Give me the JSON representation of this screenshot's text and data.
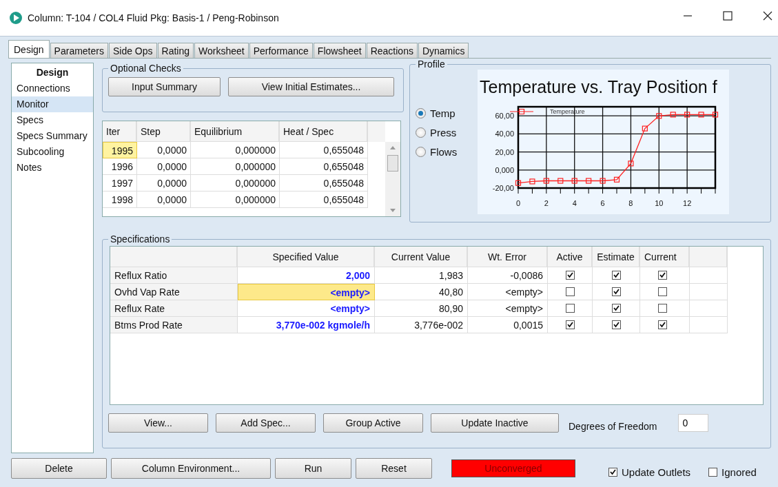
{
  "window": {
    "title": "Column: T-104 / COL4  Fluid Pkg: Basis-1 / Peng-Robinson"
  },
  "tabs": [
    {
      "label": "Design",
      "selected": true
    },
    {
      "label": "Parameters",
      "selected": false
    },
    {
      "label": "Side Ops",
      "selected": false
    },
    {
      "label": "Rating",
      "selected": false
    },
    {
      "label": "Worksheet",
      "selected": false
    },
    {
      "label": "Performance",
      "selected": false
    },
    {
      "label": "Flowsheet",
      "selected": false
    },
    {
      "label": "Reactions",
      "selected": false
    },
    {
      "label": "Dynamics",
      "selected": false
    }
  ],
  "sidebar": {
    "heading": "Design",
    "items": [
      {
        "label": "Connections",
        "selected": false
      },
      {
        "label": "Monitor",
        "selected": true
      },
      {
        "label": "Specs",
        "selected": false
      },
      {
        "label": "Specs Summary",
        "selected": false
      },
      {
        "label": "Subcooling",
        "selected": false
      },
      {
        "label": "Notes",
        "selected": false
      }
    ]
  },
  "optional_checks": {
    "title": "Optional Checks",
    "buttons": [
      "Input Summary",
      "View Initial Estimates..."
    ]
  },
  "iterations": {
    "columns": [
      "Iter",
      "Step",
      "Equilibrium",
      "Heat / Spec"
    ],
    "rows": [
      {
        "cells": [
          "1995",
          "0,0000",
          "0,000000",
          "0,655048"
        ],
        "selected": true
      },
      {
        "cells": [
          "1996",
          "0,0000",
          "0,000000",
          "0,655048"
        ],
        "selected": false
      },
      {
        "cells": [
          "1997",
          "0,0000",
          "0,000000",
          "0,655048"
        ],
        "selected": false
      },
      {
        "cells": [
          "1998",
          "0,0000",
          "0,000000",
          "0,655048"
        ],
        "selected": false
      }
    ]
  },
  "profile": {
    "title": "Profile",
    "options": [
      {
        "label": "Temp",
        "selected": true
      },
      {
        "label": "Press",
        "selected": false
      },
      {
        "label": "Flows",
        "selected": false
      }
    ],
    "chart_data": {
      "type": "line",
      "title": "Temperature vs. Tray Position f",
      "x": [
        0,
        1,
        2,
        3,
        4,
        5,
        6,
        7,
        8,
        9,
        10,
        11,
        12,
        13,
        14
      ],
      "grid": true,
      "series": [
        {
          "name": "Temperature",
          "color": "#ff2020",
          "marker": "square",
          "values": [
            -14.4,
            -12.7,
            -12,
            -12,
            -12,
            -12,
            -12,
            -10.7,
            7.2,
            45.9,
            59.8,
            61.3,
            61.3,
            61.3,
            61.3
          ]
        }
      ],
      "xlim": [
        0,
        14
      ],
      "ylim": [
        -20,
        70
      ],
      "xticks": [
        0,
        2,
        4,
        6,
        8,
        10,
        12
      ],
      "yticks": [
        {
          "value": -20,
          "label": "-20,00"
        },
        {
          "value": 0,
          "label": "0,000"
        },
        {
          "value": 20,
          "label": "20,00"
        },
        {
          "value": 40,
          "label": "40,00"
        },
        {
          "value": 60,
          "label": "60,00"
        }
      ]
    }
  },
  "specifications": {
    "title": "Specifications",
    "columns": [
      "Specified Value",
      "Current Value",
      "Wt. Error",
      "Active",
      "Estimate",
      "Current"
    ],
    "rows": [
      {
        "name": "Reflux Ratio",
        "specified": "2,000",
        "current_value": "1,983",
        "wt_error": "-0,0086",
        "active": true,
        "estimate": true,
        "current": true,
        "selected": false
      },
      {
        "name": "Ovhd Vap Rate",
        "specified": "<empty>",
        "current_value": "40,80",
        "wt_error": "<empty>",
        "active": false,
        "estimate": true,
        "current": false,
        "selected": true
      },
      {
        "name": "Reflux Rate",
        "specified": "<empty>",
        "current_value": "80,90",
        "wt_error": "<empty>",
        "active": false,
        "estimate": true,
        "current": false,
        "selected": false
      },
      {
        "name": "Btms Prod Rate",
        "specified": "3,770e-002 kgmole/h",
        "current_value": "3,776e-002",
        "wt_error": "0,0015",
        "active": true,
        "estimate": true,
        "current": true,
        "selected": false
      }
    ],
    "buttons": [
      "View...",
      "Add Spec...",
      "Group Active",
      "Update Inactive"
    ],
    "degrees_of_freedom": {
      "label": "Degrees of Freedom",
      "value": "0"
    }
  },
  "bottom_bar": {
    "buttons": [
      "Delete",
      "Column Environment...",
      "Run",
      "Reset"
    ],
    "status": "Unconverged",
    "checkboxes": [
      {
        "label": "Update Outlets",
        "checked": true
      },
      {
        "label": "Ignored",
        "checked": false
      }
    ]
  }
}
